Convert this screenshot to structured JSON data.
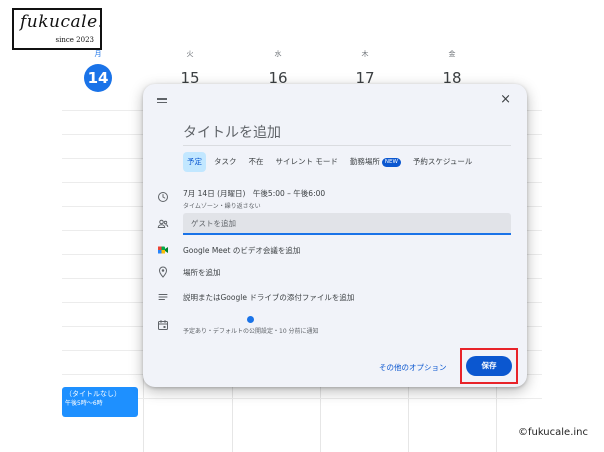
{
  "logo": {
    "wordmark": "fukucale.",
    "since": "since 2023"
  },
  "calendar": {
    "days": [
      {
        "dow": "月",
        "num": "14",
        "today": true
      },
      {
        "dow": "火",
        "num": "15",
        "today": false
      },
      {
        "dow": "水",
        "num": "16",
        "today": false
      },
      {
        "dow": "木",
        "num": "17",
        "today": false
      },
      {
        "dow": "金",
        "num": "18",
        "today": false
      }
    ],
    "event": {
      "title": "（タイトルなし）",
      "time": "午後5時～6時"
    }
  },
  "dialog": {
    "close_label": "×",
    "title_placeholder": "タイトルを追加",
    "tabs": [
      {
        "label": "予定",
        "active": true
      },
      {
        "label": "タスク",
        "active": false
      },
      {
        "label": "不在",
        "active": false
      },
      {
        "label": "サイレント モード",
        "active": false
      },
      {
        "label": "勤務場所",
        "active": false,
        "badge": "NEW"
      },
      {
        "label": "予約スケジュール",
        "active": false
      }
    ],
    "datetime": "7月 14日 (月曜日)　午後5:00 – 午後6:00",
    "timezone": "タイムゾーン・繰り返さない",
    "guest_placeholder": "ゲストを追加",
    "meet": "Google Meet のビデオ会議を追加",
    "location": "場所を追加",
    "description": "説明またはGoogle ドライブの添付ファイルを追加",
    "calendar_info": "予定あり・デフォルトの公開設定・10 分前に通知",
    "more_options": "その他のオプション",
    "save": "保存"
  },
  "copyright": "©fukucale.inc",
  "colors": {
    "accent": "#1a73e8",
    "save": "#0b57d0",
    "highlight": "#e8232a",
    "event": "#1e90ff"
  }
}
